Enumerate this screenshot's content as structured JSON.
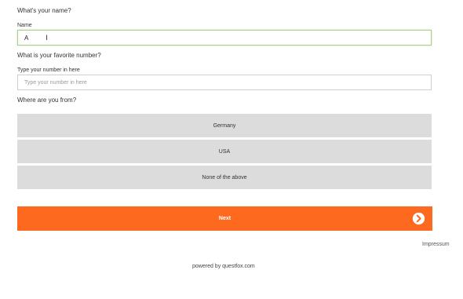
{
  "questions": {
    "name": {
      "title": "What's your name?",
      "label": "Name",
      "value": "A"
    },
    "number": {
      "title": "What is your favorite number?",
      "label": "Type your number in here",
      "placeholder": "Type your number in here"
    },
    "origin": {
      "title": "Where are you from?",
      "options": [
        "Germany",
        "USA",
        "None of the above"
      ]
    }
  },
  "next_button": {
    "label": "Next",
    "icon": "arrow-right-circle-icon",
    "color": "#fd6a1f"
  },
  "footer": {
    "impressum": "Impressum",
    "powered_by": "powered by questfox.com"
  }
}
